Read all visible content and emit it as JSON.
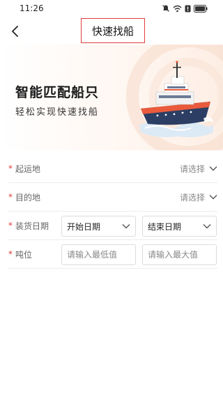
{
  "status_bar": {
    "time": "11:26",
    "icons": [
      "mute-icon",
      "wifi-icon",
      "notification-icon",
      "battery-icon"
    ]
  },
  "nav": {
    "title": "快速找船",
    "back_icon": "chevron-left-icon",
    "title_highlight_color": "#e23b3b"
  },
  "banner": {
    "title": "智能匹配船只",
    "subtitle": "轻松实现快速找船"
  },
  "form": {
    "required_mark": "*",
    "origin": {
      "label": "起运地",
      "value": "请选择"
    },
    "destination": {
      "label": "目的地",
      "value": "请选择"
    },
    "loading_date": {
      "label": "装货日期",
      "start": "开始日期",
      "end": "结束日期"
    },
    "tonnage": {
      "label": "吨位",
      "min_placeholder": "请输入最低值",
      "max_placeholder": "请输入最大值"
    }
  },
  "colors": {
    "required": "#e23b3b",
    "accent": "#f07a3a",
    "ship_hull": "#2c3e63"
  }
}
